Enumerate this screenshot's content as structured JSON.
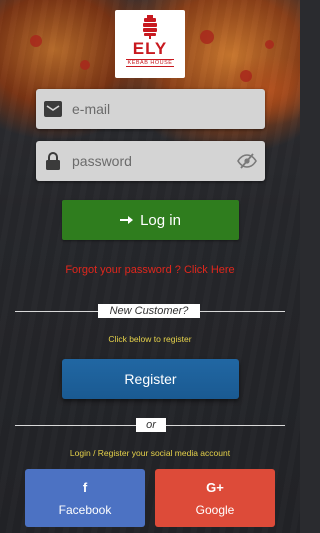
{
  "logo": {
    "brand": "ELY",
    "subtitle": "KEBAB HOUSE"
  },
  "email": {
    "placeholder": "e-mail",
    "value": ""
  },
  "password": {
    "placeholder": "password",
    "value": ""
  },
  "login": {
    "label": "Log in",
    "icon": "arrow-right-icon"
  },
  "forgot": {
    "label": "Forgot your password ? Click Here"
  },
  "new_customer": {
    "label": "New Customer?",
    "hint": "Click below to register",
    "register_label": "Register"
  },
  "or": {
    "label": "or"
  },
  "social": {
    "hint": "Login / Register your social media account",
    "facebook": {
      "icon": "f",
      "label": "Facebook"
    },
    "google": {
      "icon": "G+",
      "label": "Google"
    }
  },
  "colors": {
    "login": "#2f7d1e",
    "register": "#1a5a92",
    "facebook": "#4c72c3",
    "google": "#dd4b39",
    "link_red": "#e0271d",
    "hint_yellow": "#e6d24a"
  }
}
